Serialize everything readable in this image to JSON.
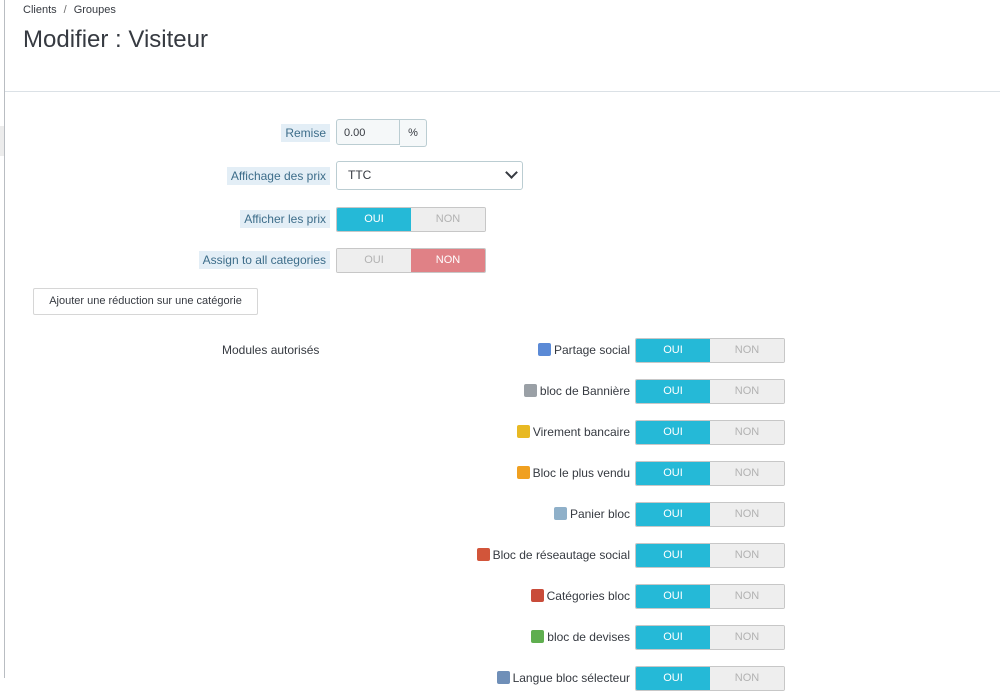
{
  "breadcrumb": {
    "item1": "Clients",
    "separator": "/",
    "item2": "Groupes"
  },
  "page_title": "Modifier : Visiteur",
  "form": {
    "remise": {
      "label": "Remise",
      "value": "0.00",
      "addon": "%"
    },
    "affichage": {
      "label": "Affichage des prix",
      "value": "TTC"
    },
    "afficher_prix": {
      "label": "Afficher les prix",
      "oui": "OUI",
      "non": "NON",
      "state": "oui"
    },
    "assign_all": {
      "label": "Assign to all categories",
      "oui": "OUI",
      "non": "NON",
      "state": "non"
    },
    "add_reduction_button": "Ajouter une réduction sur une catégorie",
    "modules_label": "Modules autorisés"
  },
  "modules": [
    {
      "name": "Partage social",
      "icon": "share-icon",
      "color": "#5b8ad6",
      "oui": "OUI",
      "non": "NON"
    },
    {
      "name": "bloc de Bannière",
      "icon": "gear-icon",
      "color": "#9aa0a6",
      "oui": "OUI",
      "non": "NON"
    },
    {
      "name": "Virement bancaire",
      "icon": "coins-icon",
      "color": "#e8b923",
      "oui": "OUI",
      "non": "NON"
    },
    {
      "name": "Bloc le plus vendu",
      "icon": "award-icon",
      "color": "#f0a020",
      "oui": "OUI",
      "non": "NON"
    },
    {
      "name": "Panier bloc",
      "icon": "basket-icon",
      "color": "#8fb0c9",
      "oui": "OUI",
      "non": "NON"
    },
    {
      "name": "Bloc de réseautage social",
      "icon": "social-icon",
      "color": "#d2553a",
      "oui": "OUI",
      "non": "NON"
    },
    {
      "name": "Catégories bloc",
      "icon": "category-icon",
      "color": "#c94c3a",
      "oui": "OUI",
      "non": "NON"
    },
    {
      "name": "bloc de devises",
      "icon": "money-icon",
      "color": "#5fae4f",
      "oui": "OUI",
      "non": "NON"
    },
    {
      "name": "Langue bloc sélecteur",
      "icon": "language-icon",
      "color": "#6f8fb8",
      "oui": "OUI",
      "non": "NON"
    }
  ],
  "colors": {
    "accent": "#25b9d7",
    "danger": "#e08186",
    "idle": "#eeeeee",
    "label_bg": "#e3eef6"
  }
}
